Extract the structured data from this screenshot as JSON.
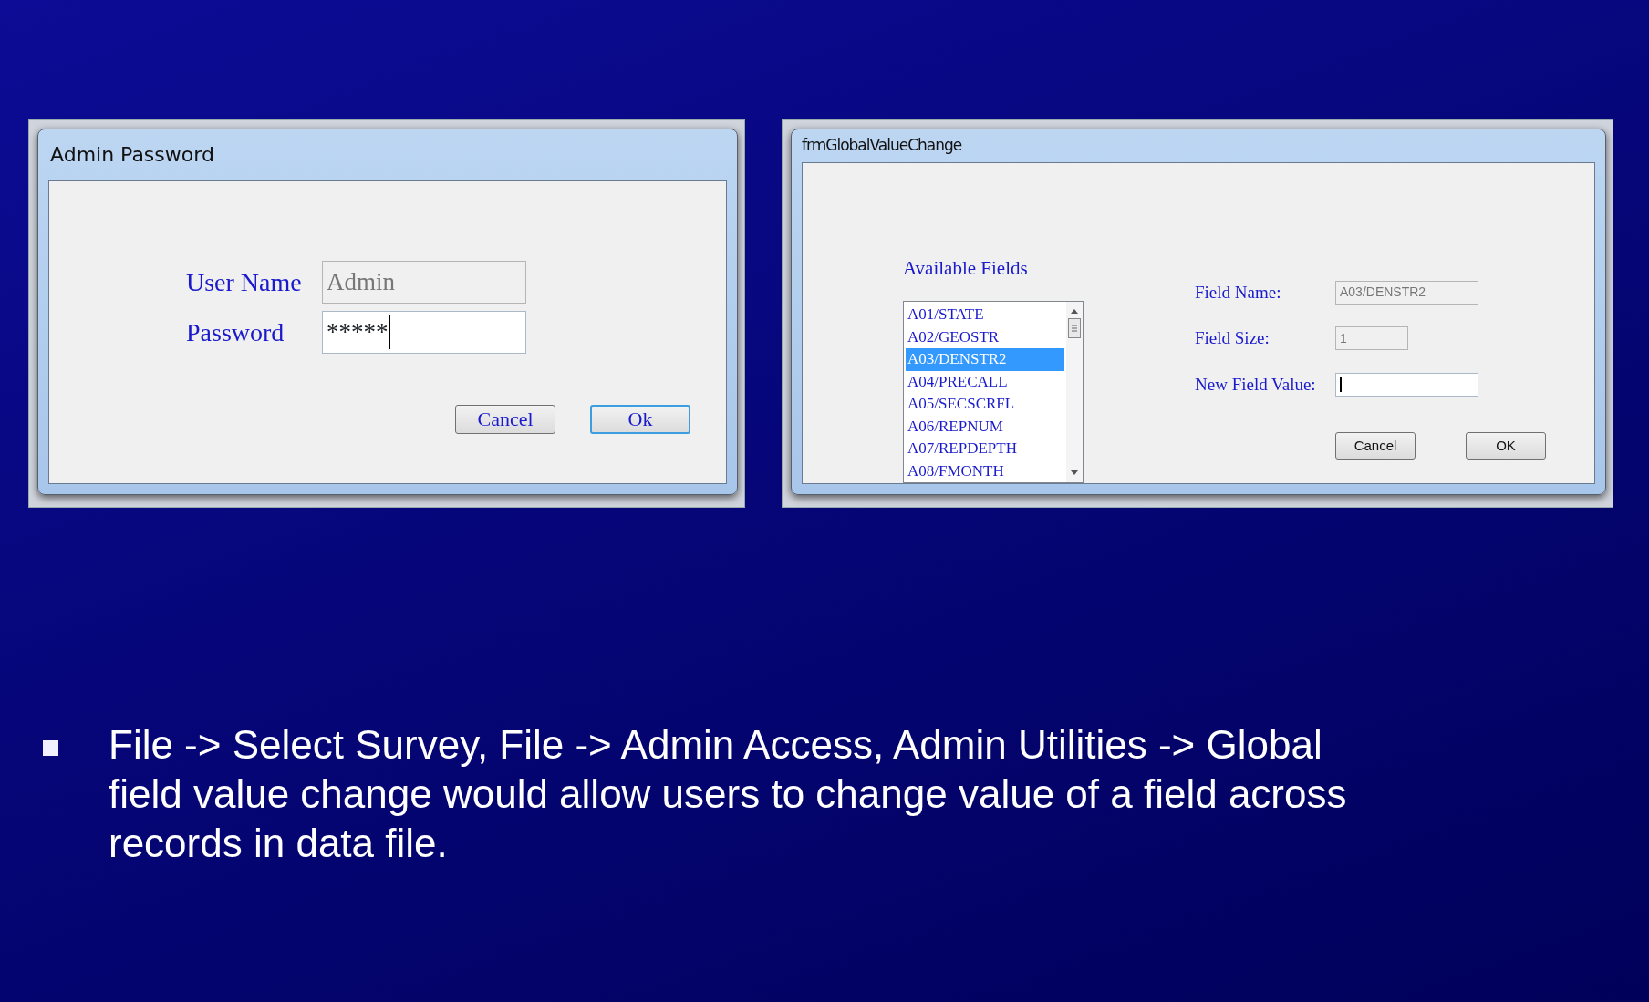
{
  "login_dialog": {
    "title": "Admin Password",
    "fields": [
      {
        "label": "User Name",
        "value": "Admin",
        "disabled": true,
        "focused": false
      },
      {
        "label": "Password",
        "value": "*****",
        "disabled": false,
        "focused": true
      }
    ],
    "buttons": [
      {
        "label": "Cancel",
        "default": false
      },
      {
        "label": "Ok",
        "default": true
      }
    ]
  },
  "value_change_dialog": {
    "title": "frmGlobalValueChange",
    "list_label": "Available Fields",
    "list_items": [
      {
        "label": "A01/STATE",
        "selected": false
      },
      {
        "label": "A02/GEOSTR",
        "selected": false
      },
      {
        "label": "A03/DENSTR2",
        "selected": true
      },
      {
        "label": "A04/PRECALL",
        "selected": false
      },
      {
        "label": "A05/SECSCRFL",
        "selected": false
      },
      {
        "label": "A06/REPNUM",
        "selected": false
      },
      {
        "label": "A07/REPDEPTH",
        "selected": false
      },
      {
        "label": "A08/FMONTH",
        "selected": false
      }
    ],
    "fields": [
      {
        "label": "Field Name:",
        "value": "A03/DENSTR2",
        "disabled": true,
        "focused": false
      },
      {
        "label": "Field Size:",
        "value": "1",
        "disabled": true,
        "focused": false
      },
      {
        "label": "New Field Value:",
        "disabled": false,
        "focused": true
      }
    ],
    "buttons": [
      {
        "label": "Cancel",
        "default": false
      },
      {
        "label": "OK",
        "default": false
      }
    ]
  },
  "bullets": [
    "File -> Select Survey, File -> Admin Access, Admin Utilities -> Global field value change would allow users to change value of a field across records in data file."
  ]
}
